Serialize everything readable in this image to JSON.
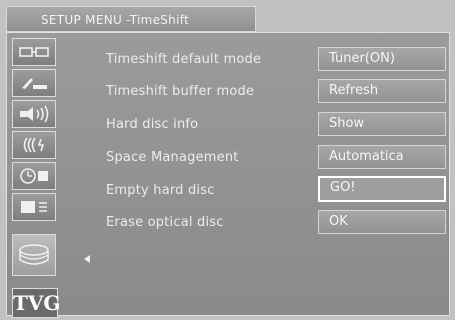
{
  "header": {
    "title": "SETUP MENU -TimeShift"
  },
  "sidebar": {
    "icons": [
      {
        "name": "picture-icon"
      },
      {
        "name": "tuning-icon"
      },
      {
        "name": "sound-icon"
      },
      {
        "name": "connections-icon"
      },
      {
        "name": "timer-icon"
      },
      {
        "name": "settings-icon"
      },
      {
        "name": "disc-icon",
        "selected": true
      }
    ],
    "brand": "TVG"
  },
  "menu": {
    "rows": [
      {
        "label": "Timeshift default mode",
        "value": "Tuner(ON)"
      },
      {
        "label": "Timeshift buffer mode",
        "value": "Refresh"
      },
      {
        "label": "Hard disc info",
        "value": "Show"
      },
      {
        "label": "Space Management",
        "value": "Automatica"
      },
      {
        "label": "Empty hard disc",
        "value": "GO!",
        "focused": true
      },
      {
        "label": "Erase optical disc",
        "value": "OK"
      }
    ]
  }
}
